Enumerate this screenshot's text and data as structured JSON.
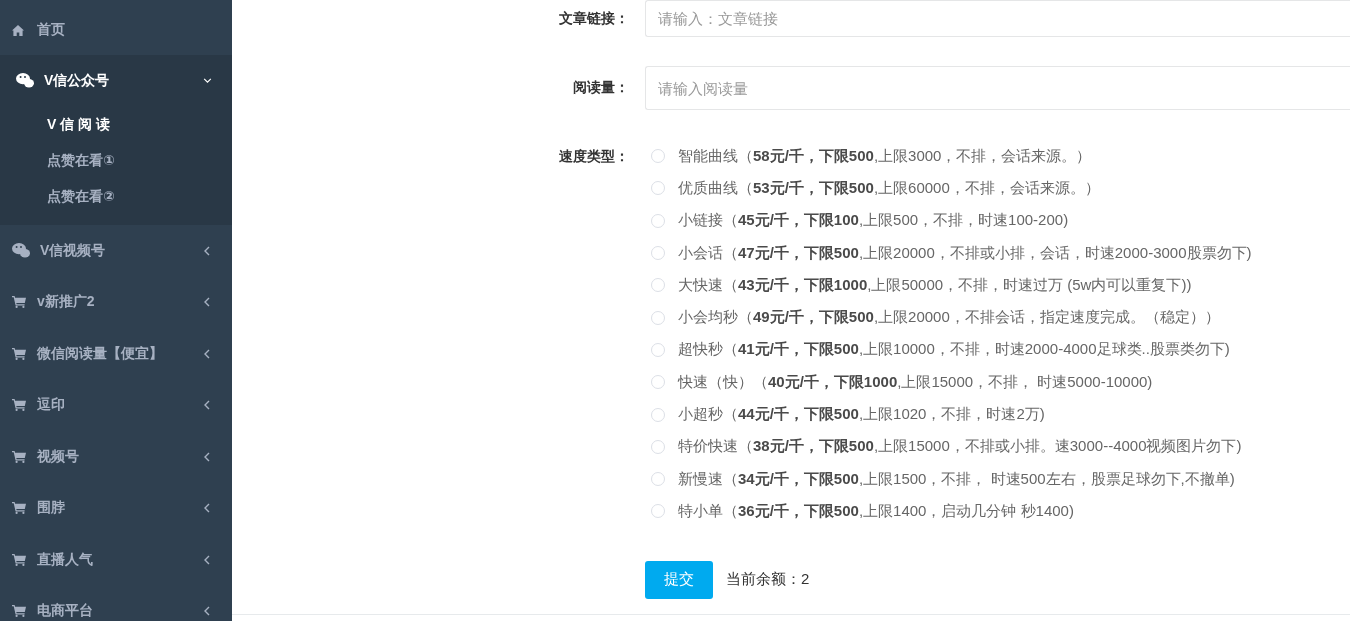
{
  "sidebar": {
    "home": {
      "label": "首页"
    },
    "menus": [
      {
        "kind": "chat",
        "label": "V信公众号",
        "expanded": true,
        "children": [
          {
            "label": "V 信 阅 读",
            "selected": true
          },
          {
            "label": "点赞在看①",
            "selected": false
          },
          {
            "label": "点赞在看②",
            "selected": false
          }
        ]
      },
      {
        "kind": "chat",
        "label": "V信视频号",
        "expanded": false
      },
      {
        "kind": "cart",
        "label": "v新推广2",
        "expanded": false
      },
      {
        "kind": "cart",
        "label": "微信阅读量【便宜】",
        "expanded": false
      },
      {
        "kind": "cart",
        "label": "逗印",
        "expanded": false
      },
      {
        "kind": "cart",
        "label": "视频号",
        "expanded": false
      },
      {
        "kind": "cart",
        "label": "围脖",
        "expanded": false
      },
      {
        "kind": "cart",
        "label": "直播人气",
        "expanded": false
      },
      {
        "kind": "cart",
        "label": "电商平台",
        "expanded": false
      }
    ]
  },
  "form": {
    "fields": [
      {
        "label": "文章链接：",
        "placeholder": "请输入：文章链接"
      },
      {
        "label": "阅读量：",
        "placeholder": "请输入阅读量"
      }
    ],
    "speed": {
      "label": "速度类型：",
      "options": [
        {
          "text": "智能曲线（**58元/千，下限500**,上限3000，不排，会话来源。）",
          "selected": false
        },
        {
          "text": "优质曲线（**53元/千，下限500**,上限60000，不排，会话来源。）",
          "selected": false
        },
        {
          "text": "小链接（**45元/千，下限100**,上限500，不排，时速100-200)",
          "selected": false
        },
        {
          "text": "小会话（**47元/千，下限500**,上限20000，不排或小排，会话，时速2000-3000股票勿下)",
          "selected": false
        },
        {
          "text": "大快速（**43元/千，下限1000**,上限50000，不排，时速过万 (5w内可以重复下))",
          "selected": false
        },
        {
          "text": "小会均秒（**49元/千，下限500**,上限20000，不排会话，指定速度完成。（稳定））",
          "selected": false
        },
        {
          "text": "超快秒（**41元/千，下限500**,上限10000，不排，时速2000-4000足球类..股票类勿下)",
          "selected": false
        },
        {
          "text": "快速（快）（**40元/千，下限1000**,上限15000，不排， 时速5000-10000)",
          "selected": false
        },
        {
          "text": "小超秒（**44元/千，下限500**,上限1020，不排，时速2万)",
          "selected": false
        },
        {
          "text": "特价快速（**38元/千，下限500**,上限15000，不排或小排。速3000--4000视频图片勿下)",
          "selected": false
        },
        {
          "text": "新慢速（**34元/千，下限500**,上限1500，不排， 时速500左右，股票足球勿下,不撤单)",
          "selected": false
        },
        {
          "text": "特小单（**36元/千，下限500**,上限1400，启动几分钟 秒1400)",
          "selected": false
        }
      ]
    },
    "submit": "提交",
    "balance": "当前余额：2"
  }
}
